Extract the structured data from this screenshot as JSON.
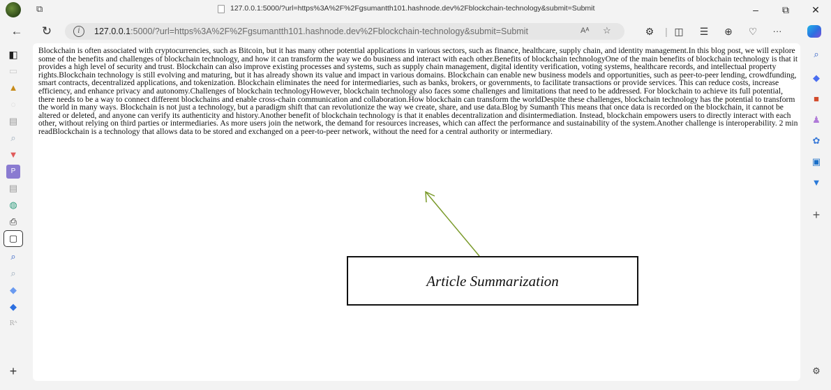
{
  "browser": {
    "title": "127.0.0.1:5000/?url=https%3A%2F%2Fgsumantth101.hashnode.dev%2Fblockchain-technology&submit=Submit",
    "url_host": "127.0.0.1",
    "url_rest": ":5000/?url=https%3A%2F%2Fgsumantth101.hashnode.dev%2Fblockchain-technology&submit=Submit",
    "more_label": "···"
  },
  "article": {
    "text": "Blockchain is often associated with cryptocurrencies, such as Bitcoin, but it has many other potential applications in various sectors, such as finance, healthcare, supply chain, and identity management.In this blog post, we will explore some of the benefits and challenges of blockchain technology, and how it can transform the way we do business and interact with each other.Benefits of blockchain technologyOne of the main benefits of blockchain technology is that it provides a high level of security and trust. Blockchain can also improve existing processes and systems, such as supply chain management, digital identity verification, voting systems, healthcare records, and intellectual property rights.Blockchain technology is still evolving and maturing, but it has already shown its value and impact in various domains. Blockchain can enable new business models and opportunities, such as peer-to-peer lending, crowdfunding, smart contracts, decentralized applications, and tokenization. Blockchain eliminates the need for intermediaries, such as banks, brokers, or governments, to facilitate transactions or provide services. This can reduce costs, increase efficiency, and enhance privacy and autonomy.Challenges of blockchain technologyHowever, blockchain technology also faces some challenges and limitations that need to be addressed. For blockchain to achieve its full potential, there needs to be a way to connect different blockchains and enable cross-chain communication and collaboration.How blockchain can transform the worldDespite these challenges, blockchain technology has the potential to transform the world in many ways. Blockchain is not just a technology, but a paradigm shift that can revolutionize the way we create, share, and use data.Blog by Sumanth This means that once data is recorded on the blockchain, it cannot be altered or deleted, and anyone can verify its authenticity and history.Another benefit of blockchain technology is that it enables decentralization and disintermediation. Instead, blockchain empowers users to directly interact with each other, without relying on third parties or intermediaries. As more users join the network, the demand for resources increases, which can affect the performance and sustainability of the system.Another challenge is interoperability. 2 min readBlockchain is a technology that allows data to be stored and exchanged on a peer-to-peer network, without the need for a central authority or intermediary."
  },
  "annotation": {
    "label": "Article Summarization",
    "color": "#7a9a2a"
  },
  "icons": {
    "back": "back-arrow-icon",
    "refresh": "refresh-icon",
    "info": "info-icon",
    "read_aloud": "read-aloud-icon",
    "favorite": "star-icon",
    "settings": "gear-icon"
  }
}
